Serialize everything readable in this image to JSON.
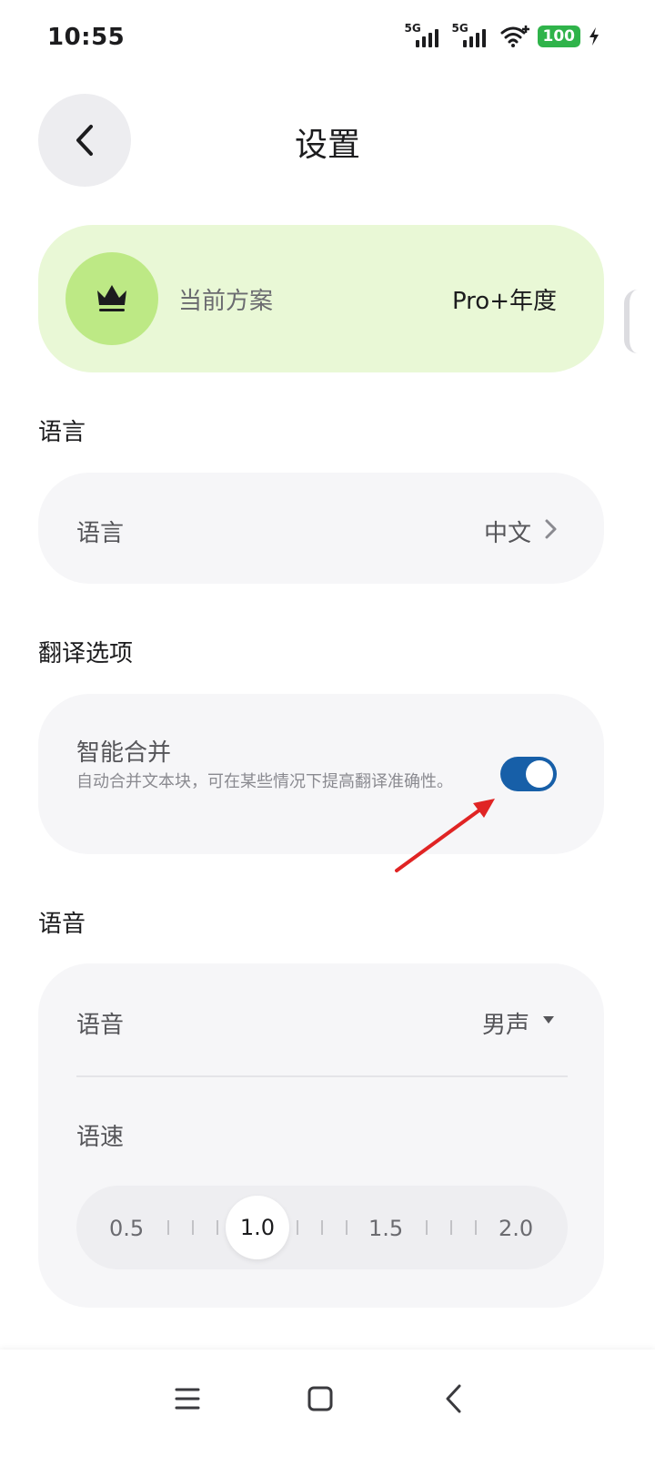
{
  "status_bar": {
    "time": "10:55",
    "signal1_label": "5G",
    "signal2_label": "5G",
    "battery": "100"
  },
  "header": {
    "title": "设置",
    "back_icon": "chevron-left-icon"
  },
  "plan": {
    "icon": "crown-icon",
    "label": "当前方案",
    "value": "Pro+年度"
  },
  "sections": {
    "language": {
      "title": "语言",
      "row_label": "语言",
      "row_value": "中文"
    },
    "translation": {
      "title": "翻译选项",
      "smart_merge_label": "智能合并",
      "smart_merge_desc": "自动合并文本块，可在某些情况下提高翻译准确性。",
      "smart_merge_enabled": true
    },
    "voice": {
      "title": "语音",
      "voice_label": "语音",
      "voice_value": "男声",
      "speed_label": "语速",
      "speed_options": [
        "0.5",
        "1.0",
        "1.5",
        "2.0"
      ],
      "speed_selected": "1.0"
    }
  },
  "colors": {
    "plan_bg": "#e9f8d6",
    "crown_bg": "#bde985",
    "toggle_on": "#175fa8",
    "annotation_arrow": "#e02424"
  },
  "nav_bar": {
    "items": [
      "menu-icon",
      "home-square-icon",
      "back-icon"
    ]
  }
}
